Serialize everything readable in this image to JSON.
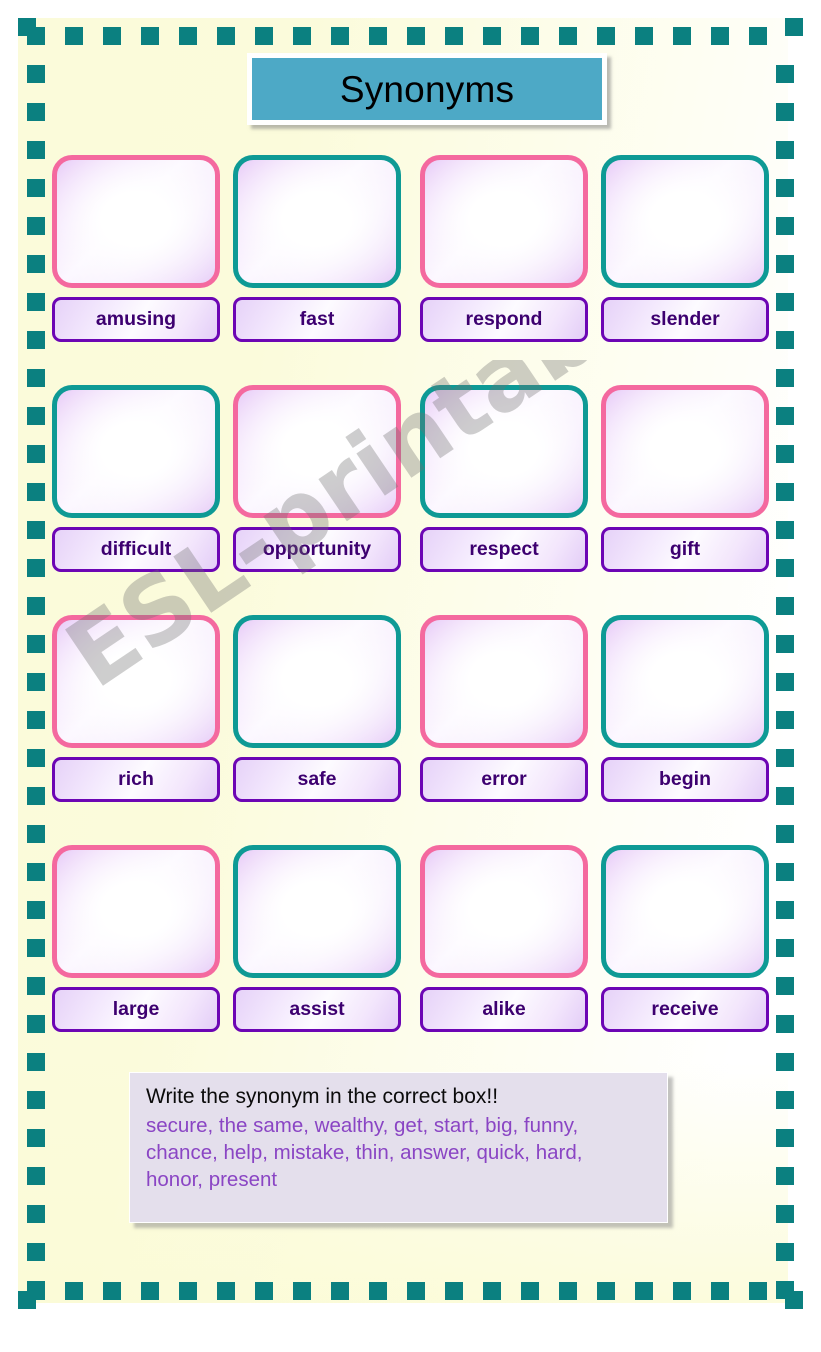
{
  "title": {
    "text": "Synonyms"
  },
  "colors": {
    "paper": "#fbfbda",
    "border_square": "#0b8080",
    "title_bar": "#4da9c6",
    "box_pink": "#f4699f",
    "box_teal": "#0e9a95",
    "word_border": "#6c05b4",
    "word_text": "#3d0070",
    "instruction_panel": "#e4dfec",
    "instruction_words": "#8a45c4"
  },
  "grid": {
    "rows": [
      {
        "cells": [
          {
            "word": "amusing",
            "box_color": "pink"
          },
          {
            "word": "fast",
            "box_color": "teal"
          },
          {
            "word": "respond",
            "box_color": "pink"
          },
          {
            "word": "slender",
            "box_color": "teal"
          }
        ]
      },
      {
        "cells": [
          {
            "word": "difficult",
            "box_color": "teal"
          },
          {
            "word": "opportunity",
            "box_color": "pink"
          },
          {
            "word": "respect",
            "box_color": "teal"
          },
          {
            "word": "gift",
            "box_color": "pink"
          }
        ]
      },
      {
        "cells": [
          {
            "word": "rich",
            "box_color": "pink"
          },
          {
            "word": "safe",
            "box_color": "teal"
          },
          {
            "word": "error",
            "box_color": "pink"
          },
          {
            "word": "begin",
            "box_color": "teal"
          }
        ]
      },
      {
        "cells": [
          {
            "word": "large",
            "box_color": "pink"
          },
          {
            "word": "assist",
            "box_color": "teal"
          },
          {
            "word": "alike",
            "box_color": "pink"
          },
          {
            "word": "receive",
            "box_color": "teal"
          }
        ]
      }
    ]
  },
  "instructions": {
    "heading": "Write the synonym in the correct box!!",
    "word_bank": "secure, the same, wealthy, get, start, big, funny, chance, help, mistake, thin, answer, quick, hard, honor, present"
  },
  "watermark": {
    "text": "ESL-printables.com"
  }
}
